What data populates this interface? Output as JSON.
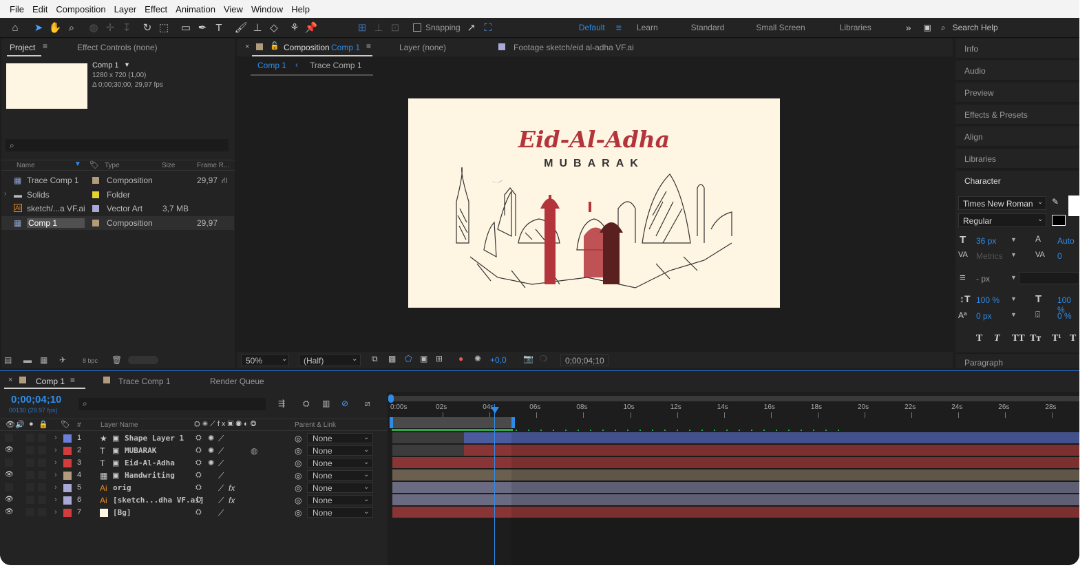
{
  "menu": [
    "File",
    "Edit",
    "Composition",
    "Layer",
    "Effect",
    "Animation",
    "View",
    "Window",
    "Help"
  ],
  "toolbar": {
    "snapping": "Snapping",
    "workspaces": [
      "Default",
      "Learn",
      "Standard",
      "Small Screen",
      "Libraries"
    ],
    "search": "Search Help"
  },
  "project": {
    "tab": "Project",
    "effect_controls": "Effect Controls (none)",
    "comp_name": "Comp 1",
    "comp_res": "1280 x 720 (1,00)",
    "comp_dur": "Δ 0;00;30;00, 29,97 fps",
    "cols": [
      "Name",
      "Type",
      "Size",
      "Frame R..."
    ],
    "items": [
      {
        "name": "Trace Comp 1",
        "type": "Composition",
        "size": "",
        "fps": "29,97",
        "color": "#b09c7c"
      },
      {
        "name": "Solids",
        "type": "Folder",
        "size": "",
        "fps": "",
        "color": "#e3d22f"
      },
      {
        "name": "sketch/...a VF.ai",
        "type": "Vector Art",
        "size": "3,7 MB",
        "fps": "",
        "color": "#a9a9d8"
      },
      {
        "name": "Comp 1",
        "type": "Composition",
        "size": "",
        "fps": "29,97",
        "color": "#b09c7c"
      }
    ],
    "bpc": "8 bpc"
  },
  "viewer": {
    "comp_tab": "Composition",
    "comp_tab_name": "Comp 1",
    "layer_tab": "Layer  (none)",
    "footage_tab": "Footage  sketch/eid al-adha VF.ai",
    "crumb1": "Comp 1",
    "crumb2": "Trace Comp 1",
    "zoom": "50%",
    "res": "(Half)",
    "exposure": "+0,0",
    "time": "0;00;04;10",
    "title": "Eid-Al-Adha",
    "subtitle": "MUBARAK"
  },
  "right": {
    "panels": [
      "Info",
      "Audio",
      "Preview",
      "Effects & Presets",
      "Align",
      "Libraries",
      "Character"
    ],
    "font": "Times New Roman",
    "style": "Regular",
    "size": "36 px",
    "leading": "Auto",
    "kerning": "Metrics",
    "tracking": "0",
    "stroke": "- px",
    "vscale": "100 %",
    "hscale": "100 %",
    "baseline": "0 px",
    "tsume": "0 %",
    "paragraph": "Paragraph"
  },
  "timeline": {
    "tab": "Comp 1",
    "tab2": "Trace Comp 1",
    "tab3": "Render Queue",
    "time": "0;00;04;10",
    "frames": "00130 (29.97 fps)",
    "col_layer": "Layer Name",
    "col_parent": "Parent & Link",
    "ruler": [
      "0:00s",
      "02s",
      "04s",
      "06s",
      "08s",
      "10s",
      "12s",
      "14s",
      "16s",
      "18s",
      "20s",
      "22s",
      "24s",
      "26s",
      "28s"
    ],
    "layers": [
      {
        "num": "1",
        "name": "Shape Layer 1",
        "color": "#6b7fd8",
        "eye": false,
        "fx": false,
        "parent": "None",
        "bar": "#4a5a9c",
        "start": 0.13
      },
      {
        "num": "2",
        "name": "MUBARAK",
        "color": "#d23c3c",
        "eye": true,
        "fx": false,
        "parent": "None",
        "bar": "#8a3535",
        "start": 0.13
      },
      {
        "num": "3",
        "name": "Eid-Al-Adha",
        "color": "#d23c3c",
        "eye": false,
        "fx": false,
        "parent": "None",
        "bar": "#8a3535",
        "start": 0
      },
      {
        "num": "4",
        "name": "Handwriting",
        "color": "#b09c7c",
        "eye": true,
        "fx": false,
        "parent": "None",
        "bar": "#6b6050",
        "start": 0
      },
      {
        "num": "5",
        "name": "orig",
        "color": "#a9a9d8",
        "eye": false,
        "fx": true,
        "parent": "None",
        "bar": "#6a6a80",
        "start": 0
      },
      {
        "num": "6",
        "name": "[sketch...dha VF.ai]",
        "color": "#a9a9d8",
        "eye": true,
        "fx": true,
        "parent": "None",
        "bar": "#6a6a80",
        "start": 0
      },
      {
        "num": "7",
        "name": "[Bg]",
        "color": "#d23c3c",
        "eye": true,
        "fx": false,
        "parent": "None",
        "bar": "#8a3535",
        "start": 0
      }
    ]
  }
}
